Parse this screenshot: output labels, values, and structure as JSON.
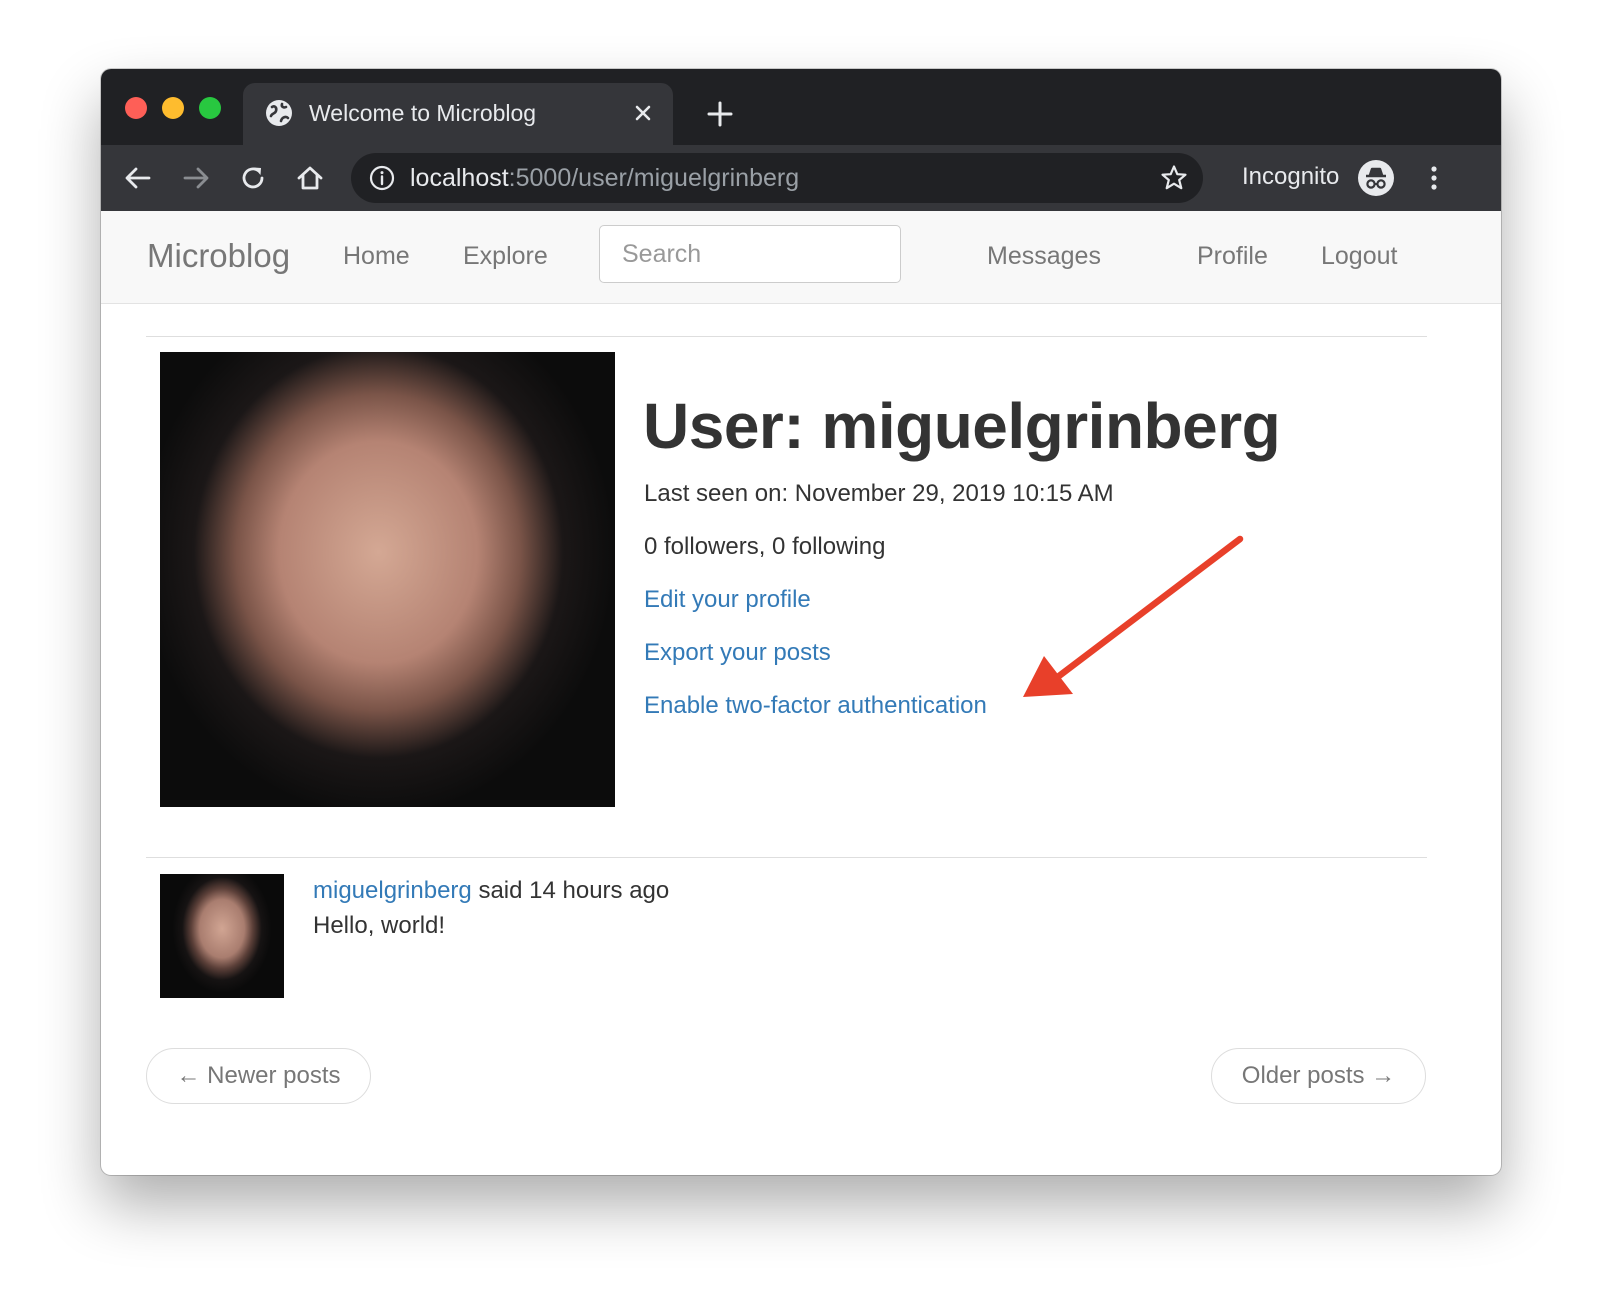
{
  "browser": {
    "tab_title": "Welcome to Microblog",
    "url_host": "localhost",
    "url_path": ":5000/user/miguelgrinberg",
    "incognito_label": "Incognito"
  },
  "navbar": {
    "brand": "Microblog",
    "home": "Home",
    "explore": "Explore",
    "search_placeholder": "Search",
    "messages": "Messages",
    "profile": "Profile",
    "logout": "Logout"
  },
  "profile": {
    "title": "User: miguelgrinberg",
    "last_seen": "Last seen on: November 29, 2019 10:15 AM",
    "follow_counts": "0 followers, 0 following",
    "edit_link": "Edit your profile",
    "export_link": "Export your posts",
    "two_factor_link": "Enable two-factor authentication"
  },
  "posts": [
    {
      "author": "miguelgrinberg",
      "when": "said 14 hours ago",
      "body": "Hello, world!"
    }
  ],
  "pager": {
    "newer": "← Newer posts",
    "older": "Older posts →"
  },
  "colors": {
    "link": "#337ab7",
    "annotation_arrow": "#e8402a",
    "traffic_red": "#fe5f57",
    "traffic_yellow": "#febc2e",
    "traffic_green": "#28c840"
  }
}
